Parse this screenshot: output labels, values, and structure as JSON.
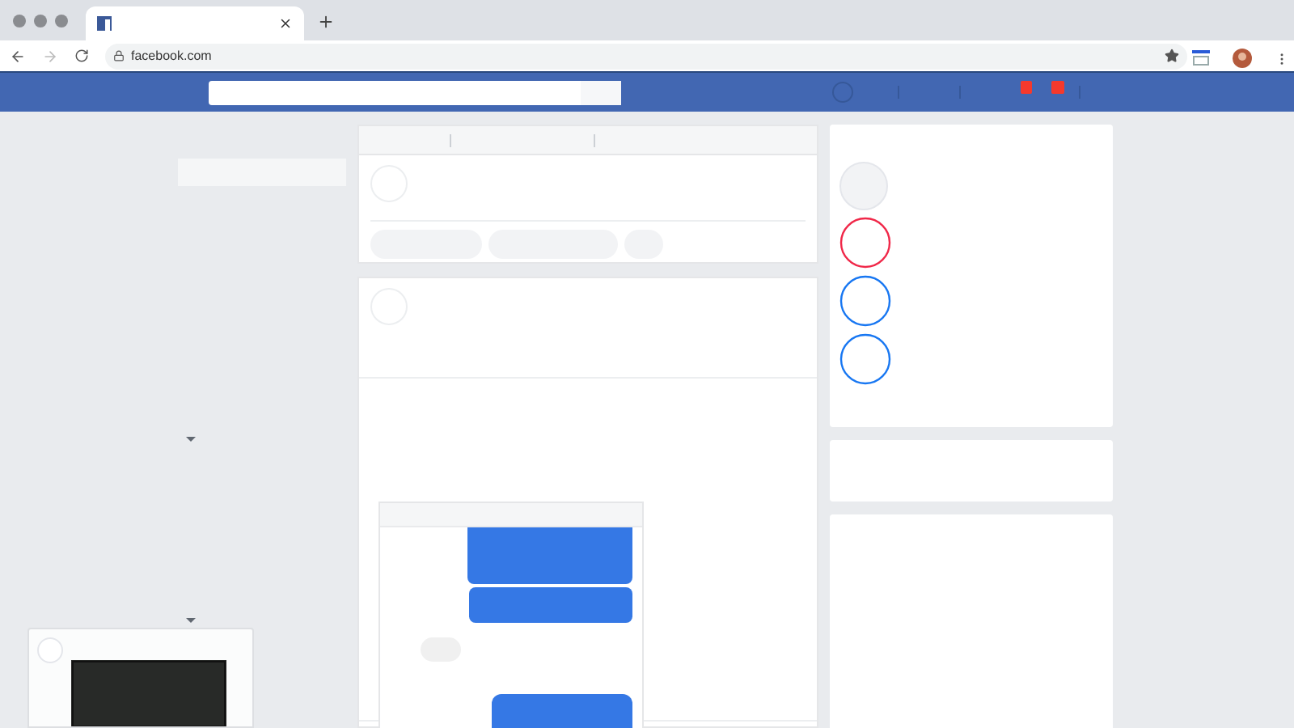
{
  "browser": {
    "url": "facebook.com"
  },
  "header": {
    "badges": [
      {
        "color": "#f5392c"
      },
      {
        "color": "#f5392c"
      }
    ]
  },
  "stories": [
    {
      "kind": "filled"
    },
    {
      "kind": "ring",
      "color": "#f02849"
    },
    {
      "kind": "ring",
      "color": "#1877f2"
    },
    {
      "kind": "ring",
      "color": "#1877f2"
    }
  ]
}
